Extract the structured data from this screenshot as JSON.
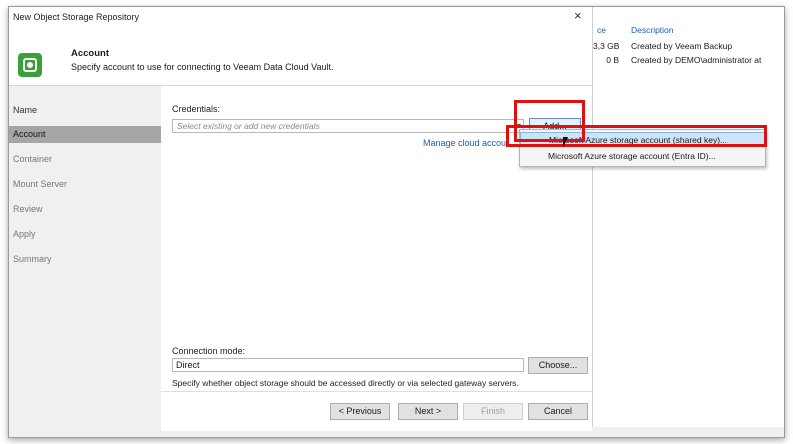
{
  "window": {
    "title": "New Object Storage Repository",
    "close_glyph": "×"
  },
  "header": {
    "title": "Account",
    "subtitle": "Specify account to use for connecting to Veeam Data Cloud Vault.",
    "icon": "object-storage-icon",
    "icon_color": "#3aa13a"
  },
  "sidebar": {
    "items": [
      {
        "label": "Name",
        "state": "done"
      },
      {
        "label": "Account",
        "state": "active"
      },
      {
        "label": "Container",
        "state": "pending"
      },
      {
        "label": "Mount Server",
        "state": "pending"
      },
      {
        "label": "Review",
        "state": "pending"
      },
      {
        "label": "Apply",
        "state": "pending"
      },
      {
        "label": "Summary",
        "state": "pending"
      }
    ]
  },
  "credentials": {
    "label": "Credentials:",
    "placeholder": "Select existing or add new credentials",
    "add_label": "Add...",
    "manage_link": "Manage cloud accour"
  },
  "add_menu": {
    "items": [
      {
        "label": "Microsoft Azure storage account (shared key)...",
        "highlighted": true
      },
      {
        "label": "Microsoft Azure storage account (Entra ID)...",
        "highlighted": false
      }
    ]
  },
  "connection": {
    "label": "Connection mode:",
    "value": "Direct",
    "choose_label": "Choose...",
    "help": "Specify whether object storage should be accessed directly or via selected gateway servers."
  },
  "footer": {
    "previous": "< Previous",
    "next": "Next >",
    "finish": "Finish",
    "cancel": "Cancel"
  },
  "background_window": {
    "headers": {
      "col_a": "ce",
      "col_b": "Description"
    },
    "rows": [
      {
        "size": "3,3 GB",
        "description": "Created by Veeam Backup"
      },
      {
        "size": "0 B",
        "description": "Created by DEMO\\administrator at"
      }
    ]
  },
  "colors": {
    "highlight_box": "#e01010",
    "link": "#1a5fb4",
    "menu_highlight": "#cce4f7",
    "active_nav": "#a6a6a6"
  }
}
